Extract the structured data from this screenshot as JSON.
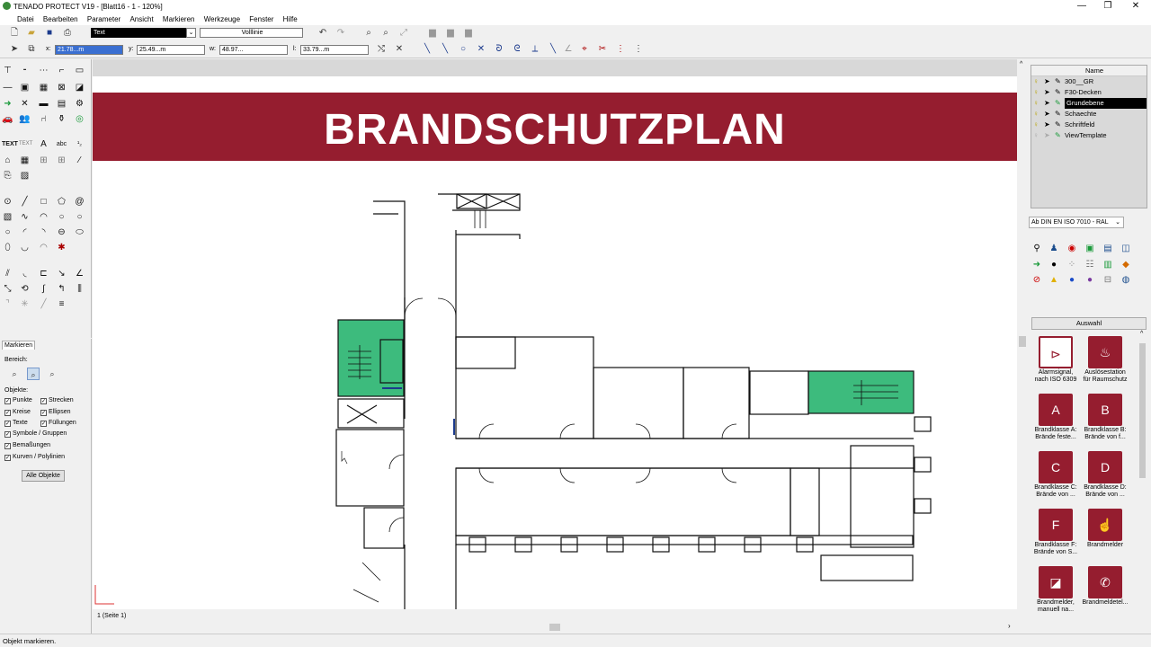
{
  "window": {
    "title": "TENADO PROTECT V19 - [Blatt16 - 1 - 120%]",
    "minimize": "—",
    "restore": "❐",
    "close": "✕"
  },
  "menu": [
    "Datei",
    "Bearbeiten",
    "Parameter",
    "Ansicht",
    "Markieren",
    "Werkzeuge",
    "Fenster",
    "Hilfe"
  ],
  "toolbar": {
    "text_style": "Text",
    "line_style": "Volllinie"
  },
  "coords": {
    "x_label": "x:",
    "x_value": "21.78...m",
    "y_label": "y:",
    "y_value": "25.49...m",
    "w_label": "w:",
    "w_value": "48.97...",
    "l_label": "l:",
    "l_value": "33.79...m"
  },
  "mark_panel": {
    "tab": "Markieren",
    "bereich_label": "Bereich:",
    "objekte_label": "Objekte:",
    "checkboxes": [
      "Punkte",
      "Strecken",
      "Kreise",
      "Ellipsen",
      "Texte",
      "Füllungen",
      "Symbole / Gruppen",
      "Bemaßungen",
      "Kurven / Polylinien"
    ],
    "all_button": "Alle Objekte"
  },
  "canvas": {
    "plan_title": "BRANDSCHUTZPLAN",
    "page_tab": "1 (Seite 1)",
    "accent_color": "#951d2f",
    "green_area_color": "#3dbb7d"
  },
  "layers": {
    "header": "Name",
    "rows": [
      "300__GR",
      "F30-Decken",
      "Grundebene",
      "Schaechte",
      "Schriftfeld",
      "ViewTemplate"
    ],
    "selected": "Grundebene"
  },
  "symbol_library": {
    "ral_select": "Ab DIN EN ISO 7010 - RAL",
    "selection_header": "Auswahl",
    "symbols": [
      {
        "label": "Alarmsignal, nach ISO 6309",
        "icon": "alarm-horn-icon"
      },
      {
        "label": "Auslösestation für Raumschutz",
        "icon": "fire-extinguisher-icon"
      },
      {
        "label": "Brandklasse A: Brände feste...",
        "icon": "fire-class-a-icon"
      },
      {
        "label": "Brandklasse B: Brände von f...",
        "icon": "fire-class-b-icon"
      },
      {
        "label": "Brandklasse C: Brände von ...",
        "icon": "fire-class-c-icon"
      },
      {
        "label": "Brandklasse D: Brände von ...",
        "icon": "fire-class-d-icon"
      },
      {
        "label": "Brandklasse F: Brände von S...",
        "icon": "fire-class-f-icon"
      },
      {
        "label": "Brandmelder",
        "icon": "fire-detector-icon"
      },
      {
        "label": "Brandmelder, manuell na...",
        "icon": "manual-call-point-icon"
      },
      {
        "label": "Brandmeldetel...",
        "icon": "fire-phone-icon"
      }
    ]
  },
  "status": {
    "text": "Objekt markieren."
  }
}
